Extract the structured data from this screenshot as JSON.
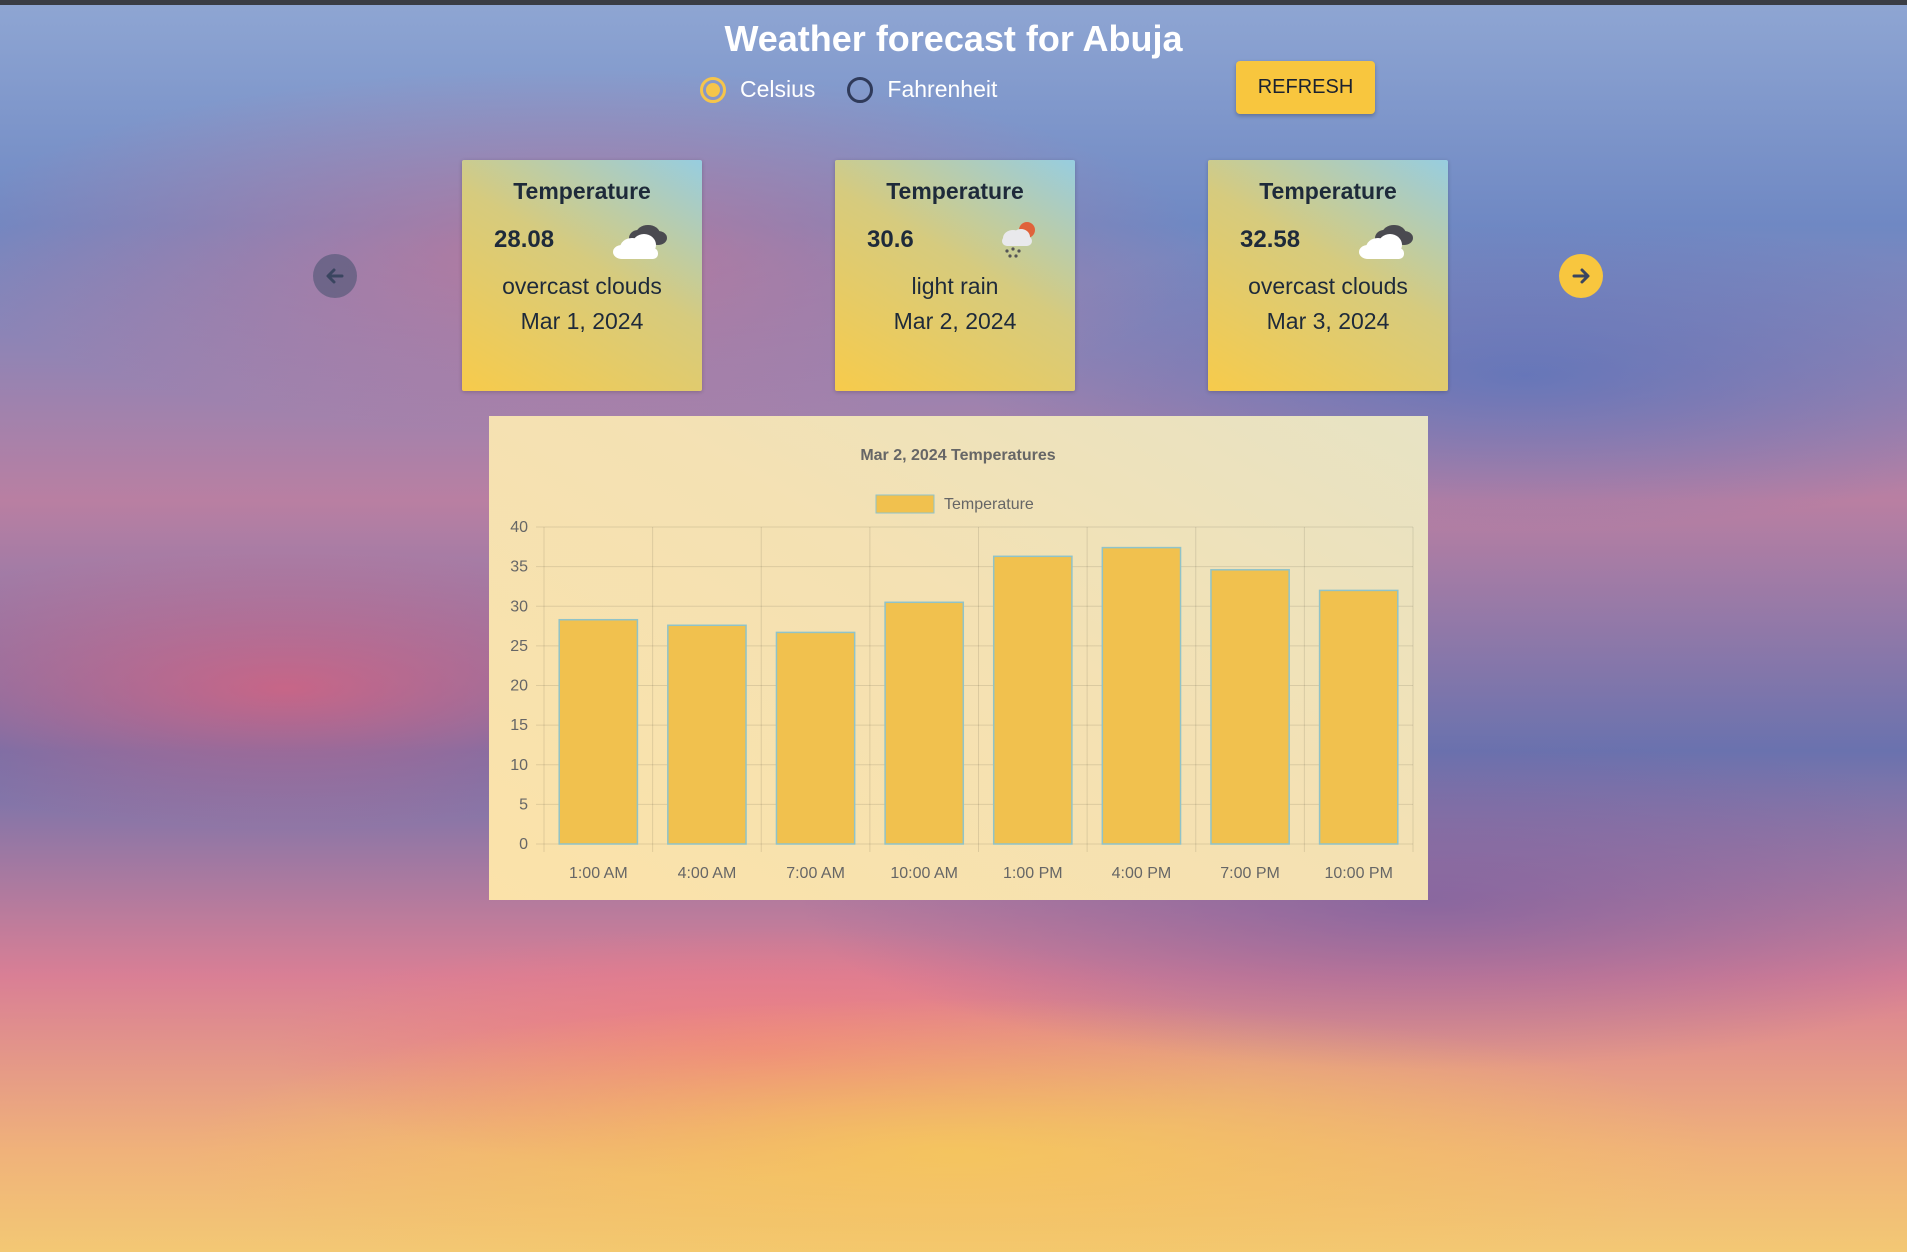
{
  "page": {
    "title": "Weather forecast for Abuja"
  },
  "units": [
    {
      "label": "Celsius",
      "checked": true
    },
    {
      "label": "Fahrenheit",
      "checked": false
    }
  ],
  "refresh_label": "REFRESH",
  "cards": [
    {
      "label": "Temperature",
      "temp": "28.08",
      "icon": "cloud-icon",
      "desc": "overcast clouds",
      "date": "Mar 1, 2024"
    },
    {
      "label": "Temperature",
      "temp": "30.6",
      "icon": "rain-icon",
      "desc": "light rain",
      "date": "Mar 2, 2024"
    },
    {
      "label": "Temperature",
      "temp": "32.58",
      "icon": "cloud-icon",
      "desc": "overcast clouds",
      "date": "Mar 3, 2024"
    }
  ],
  "colors": {
    "accent": "#f8c63e",
    "bar_fill": "#f1c14e",
    "bar_border": "#8fc3c9"
  },
  "chart_data": {
    "type": "bar",
    "title": "Mar 2, 2024 Temperatures",
    "categories": [
      "1:00 AM",
      "4:00 AM",
      "7:00 AM",
      "10:00 AM",
      "1:00 PM",
      "4:00 PM",
      "7:00 PM",
      "10:00 PM"
    ],
    "series": [
      {
        "name": "Temperature",
        "values": [
          28.3,
          27.6,
          26.7,
          30.5,
          36.3,
          37.4,
          34.6,
          32.0
        ]
      }
    ],
    "yticks": [
      0,
      5,
      10,
      15,
      20,
      25,
      30,
      35,
      40
    ],
    "ylim": [
      0,
      40
    ],
    "grid": true,
    "legend": "top-center"
  }
}
